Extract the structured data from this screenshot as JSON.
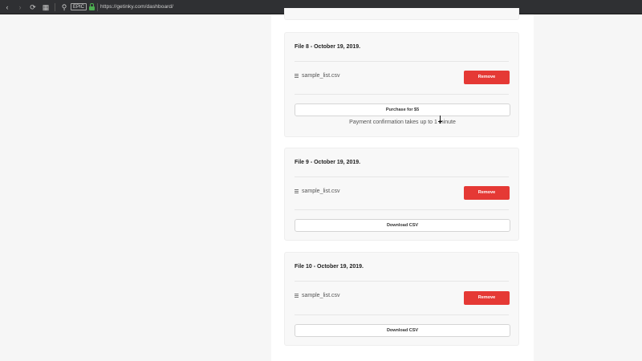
{
  "browser": {
    "back_icon": "‹",
    "forward_icon": "›",
    "reload_icon": "⟳",
    "grid_icon": "▦",
    "search_icon": "⚲",
    "badge": "EPIC",
    "url": "https://getinky.com/dashboard/"
  },
  "files": [
    {
      "title": "File 8 - October 19, 2019.",
      "filename": "sample_list.csv",
      "remove_label": "Remove",
      "action_label": "Purchase for $5",
      "note": "Payment confirmation takes up to 1 minute"
    },
    {
      "title": "File 9 - October 19, 2019.",
      "filename": "sample_list.csv",
      "remove_label": "Remove",
      "action_label": "Download CSV"
    },
    {
      "title": "File 10 - October 19, 2019.",
      "filename": "sample_list.csv",
      "remove_label": "Remove",
      "action_label": "Download CSV"
    }
  ],
  "colors": {
    "remove_button": "#e53935",
    "secure_lock": "#4caf50"
  }
}
